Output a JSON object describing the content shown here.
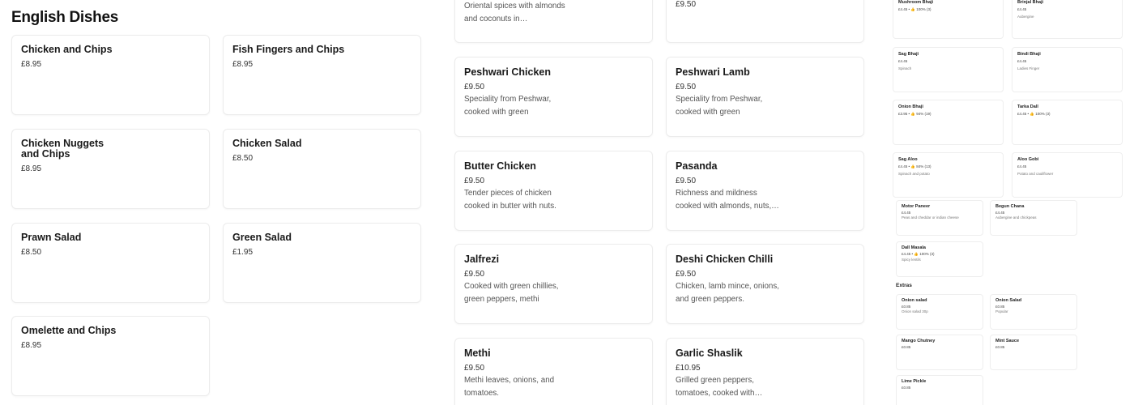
{
  "left": {
    "section_title": "English Dishes",
    "items": [
      {
        "name": "Chicken and Chips",
        "price": "£8.95"
      },
      {
        "name": "Fish Fingers and Chips",
        "price": "£8.95"
      },
      {
        "name": "Chicken Nuggets and Chips",
        "price": "£8.95"
      },
      {
        "name": "Chicken Salad",
        "price": "£8.50"
      },
      {
        "name": "Prawn Salad",
        "price": "£8.50"
      },
      {
        "name": "Green Salad",
        "price": "£1.95"
      },
      {
        "name": "Omelette and Chips",
        "price": "£8.95"
      }
    ]
  },
  "middle": {
    "top_partial": {
      "desc": "Oriental spices with almonds and coconuts in…",
      "price_right": "£9.50"
    },
    "items": [
      {
        "name": "Peshwari Chicken",
        "price": "£9.50",
        "desc": "Speciality from Peshwar, cooked with green peppers,…"
      },
      {
        "name": "Peshwari Lamb",
        "price": "£9.50",
        "desc": "Speciality from Peshwar, cooked with green peppers,…"
      },
      {
        "name": "Butter Chicken",
        "price": "£9.50",
        "desc": "Tender pieces of chicken cooked in butter with nuts."
      },
      {
        "name": "Pasanda",
        "price": "£9.50",
        "desc": "Richness and mildness cooked with almonds, nuts,…"
      },
      {
        "name": "Jalfrezi",
        "price": "£9.50",
        "desc": "Cooked with green chillies, green peppers, methi leave…"
      },
      {
        "name": "Deshi Chicken Chilli",
        "price": "£9.50",
        "desc": "Chicken, lamb mince, onions, and green peppers."
      },
      {
        "name": "Methi",
        "price": "£9.50",
        "desc": "Methi leaves, onions, and tomatoes."
      },
      {
        "name": "Garlic Shaslik",
        "price": "£10.95",
        "desc": "Grilled green peppers, tomatoes, cooked with…"
      }
    ]
  },
  "right": {
    "items": [
      {
        "name": "Mushroom Bhaji",
        "price": "£4.45 • 👍 100% (3)",
        "desc": ""
      },
      {
        "name": "Brinjal Bhaji",
        "price": "£4.45",
        "desc": "Aubergine"
      },
      {
        "name": "Sag Bhaji",
        "price": "£4.45",
        "desc": "Spinach"
      },
      {
        "name": "Bindi Bhaji",
        "price": "£4.45",
        "desc": "Ladies Finger"
      },
      {
        "name": "Onion Bhaji",
        "price": "£3.95 • 👍 94% (19)",
        "desc": ""
      },
      {
        "name": "Tarka Dall",
        "price": "£4.45 • 👍 100% (3)",
        "desc": ""
      },
      {
        "name": "Sag Aloo",
        "price": "£4.45 • 👍 84% (13)",
        "desc": "Spinach and potato"
      },
      {
        "name": "Aloo Gobi",
        "price": "£4.45",
        "desc": "Potato and cauliflower"
      },
      {
        "name": "Motor Paneer",
        "price": "£4.45",
        "desc": "Peas and cheddar or indian cheese"
      },
      {
        "name": "Begun Chana",
        "price": "£4.45",
        "desc": "Aubergine and chickpeas"
      },
      {
        "name": "Dall Masala",
        "price": "£4.45 • 👍 100% (3)",
        "desc": "Spicy lentils"
      }
    ],
    "extras_title": "Extras",
    "extras": [
      {
        "name": "Onion salad",
        "price": "£0.85",
        "desc": "Onion salad 30p"
      },
      {
        "name": "Onion Salad",
        "price": "£0.85",
        "desc": "Popular"
      },
      {
        "name": "Mango Chutney",
        "price": "£0.85",
        "desc": ""
      },
      {
        "name": "Mint Sauce",
        "price": "£0.85",
        "desc": ""
      },
      {
        "name": "Lime Pickle",
        "price": "£0.85",
        "desc": ""
      }
    ]
  }
}
